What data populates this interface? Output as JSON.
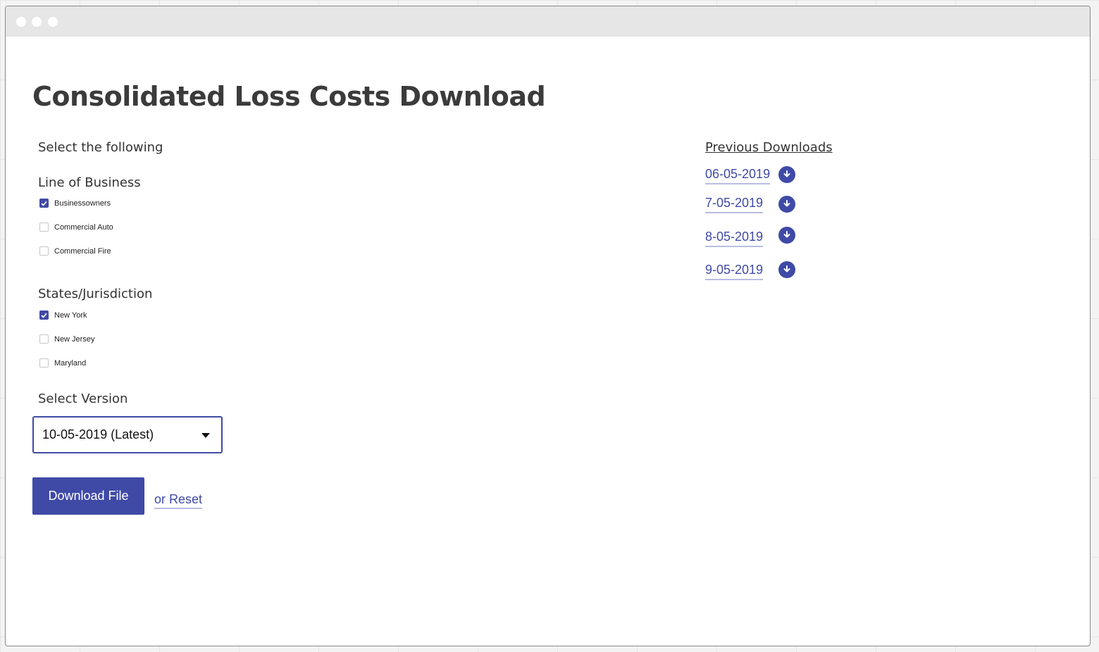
{
  "page": {
    "title": "Consolidated Loss Costs Download",
    "instructions": "Select the following"
  },
  "line_of_business": {
    "label": "Line of Business",
    "options": [
      {
        "label": "Businessowners",
        "checked": true
      },
      {
        "label": "Commercial Auto",
        "checked": false
      },
      {
        "label": "Commercial Fire",
        "checked": false
      }
    ]
  },
  "states": {
    "label": "States/Jurisdiction",
    "options": [
      {
        "label": "New York",
        "checked": true
      },
      {
        "label": "New Jersey",
        "checked": false
      },
      {
        "label": "Maryland",
        "checked": false
      }
    ]
  },
  "version": {
    "label": "Select Version",
    "selected": "10-05-2019 (Latest)"
  },
  "actions": {
    "download_label": "Download File",
    "reset_label": "or Reset"
  },
  "previous_downloads": {
    "title": "Previous Downloads",
    "items": [
      {
        "date": "06-05-2019",
        "icon": "download-circle-icon"
      },
      {
        "date": "7-05-2019",
        "icon": "download-circle-icon"
      },
      {
        "date": "8-05-2019",
        "icon": "download-circle-icon"
      },
      {
        "date": "9-05-2019",
        "icon": "download-circle-icon"
      }
    ]
  },
  "colors": {
    "accent": "#3f4aa6",
    "accent_underline": "#b8bde0",
    "title_text": "#3b3b3b"
  }
}
